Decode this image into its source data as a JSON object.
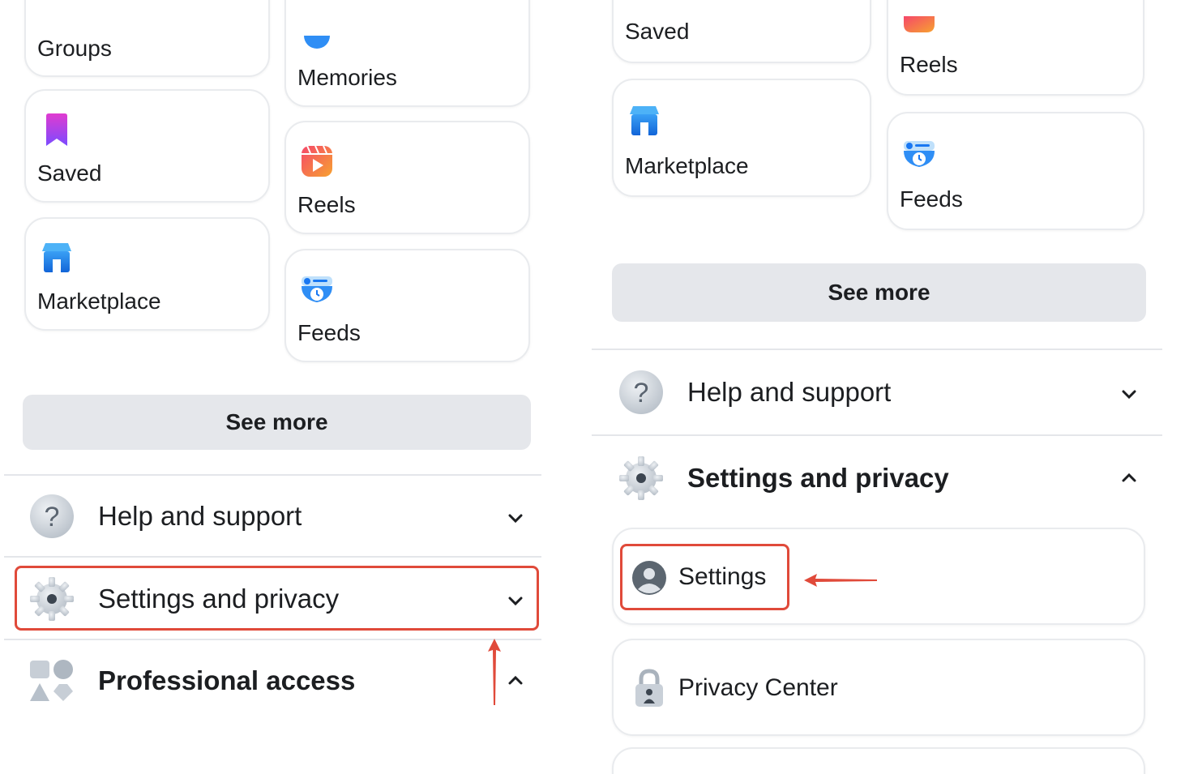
{
  "left": {
    "tiles": {
      "groups": "Groups",
      "memories": "Memories",
      "saved": "Saved",
      "reels": "Reels",
      "marketplace": "Marketplace",
      "feeds": "Feeds"
    },
    "see_more": "See more",
    "menu": {
      "help": "Help and support",
      "settings_privacy": "Settings and privacy",
      "professional": "Professional access"
    }
  },
  "right": {
    "tiles": {
      "saved": "Saved",
      "reels": "Reels",
      "marketplace": "Marketplace",
      "feeds": "Feeds"
    },
    "see_more": "See more",
    "menu": {
      "help": "Help and support",
      "settings_privacy": "Settings and privacy"
    },
    "submenu": {
      "settings": "Settings",
      "privacy_center": "Privacy Center"
    }
  },
  "colors": {
    "highlight": "#e04a3a",
    "see_more_bg": "#e5e7eb",
    "brand_blue": "#1877f2"
  },
  "icons": [
    "saved-bookmark-icon",
    "memories-icon",
    "reels-icon",
    "marketplace-store-icon",
    "feeds-icon",
    "help-question-icon",
    "settings-gear-icon",
    "professional-access-icon",
    "profile-avatar-icon",
    "privacy-lock-icon",
    "chevron-down-icon",
    "chevron-up-icon",
    "annotation-arrow-icon"
  ]
}
